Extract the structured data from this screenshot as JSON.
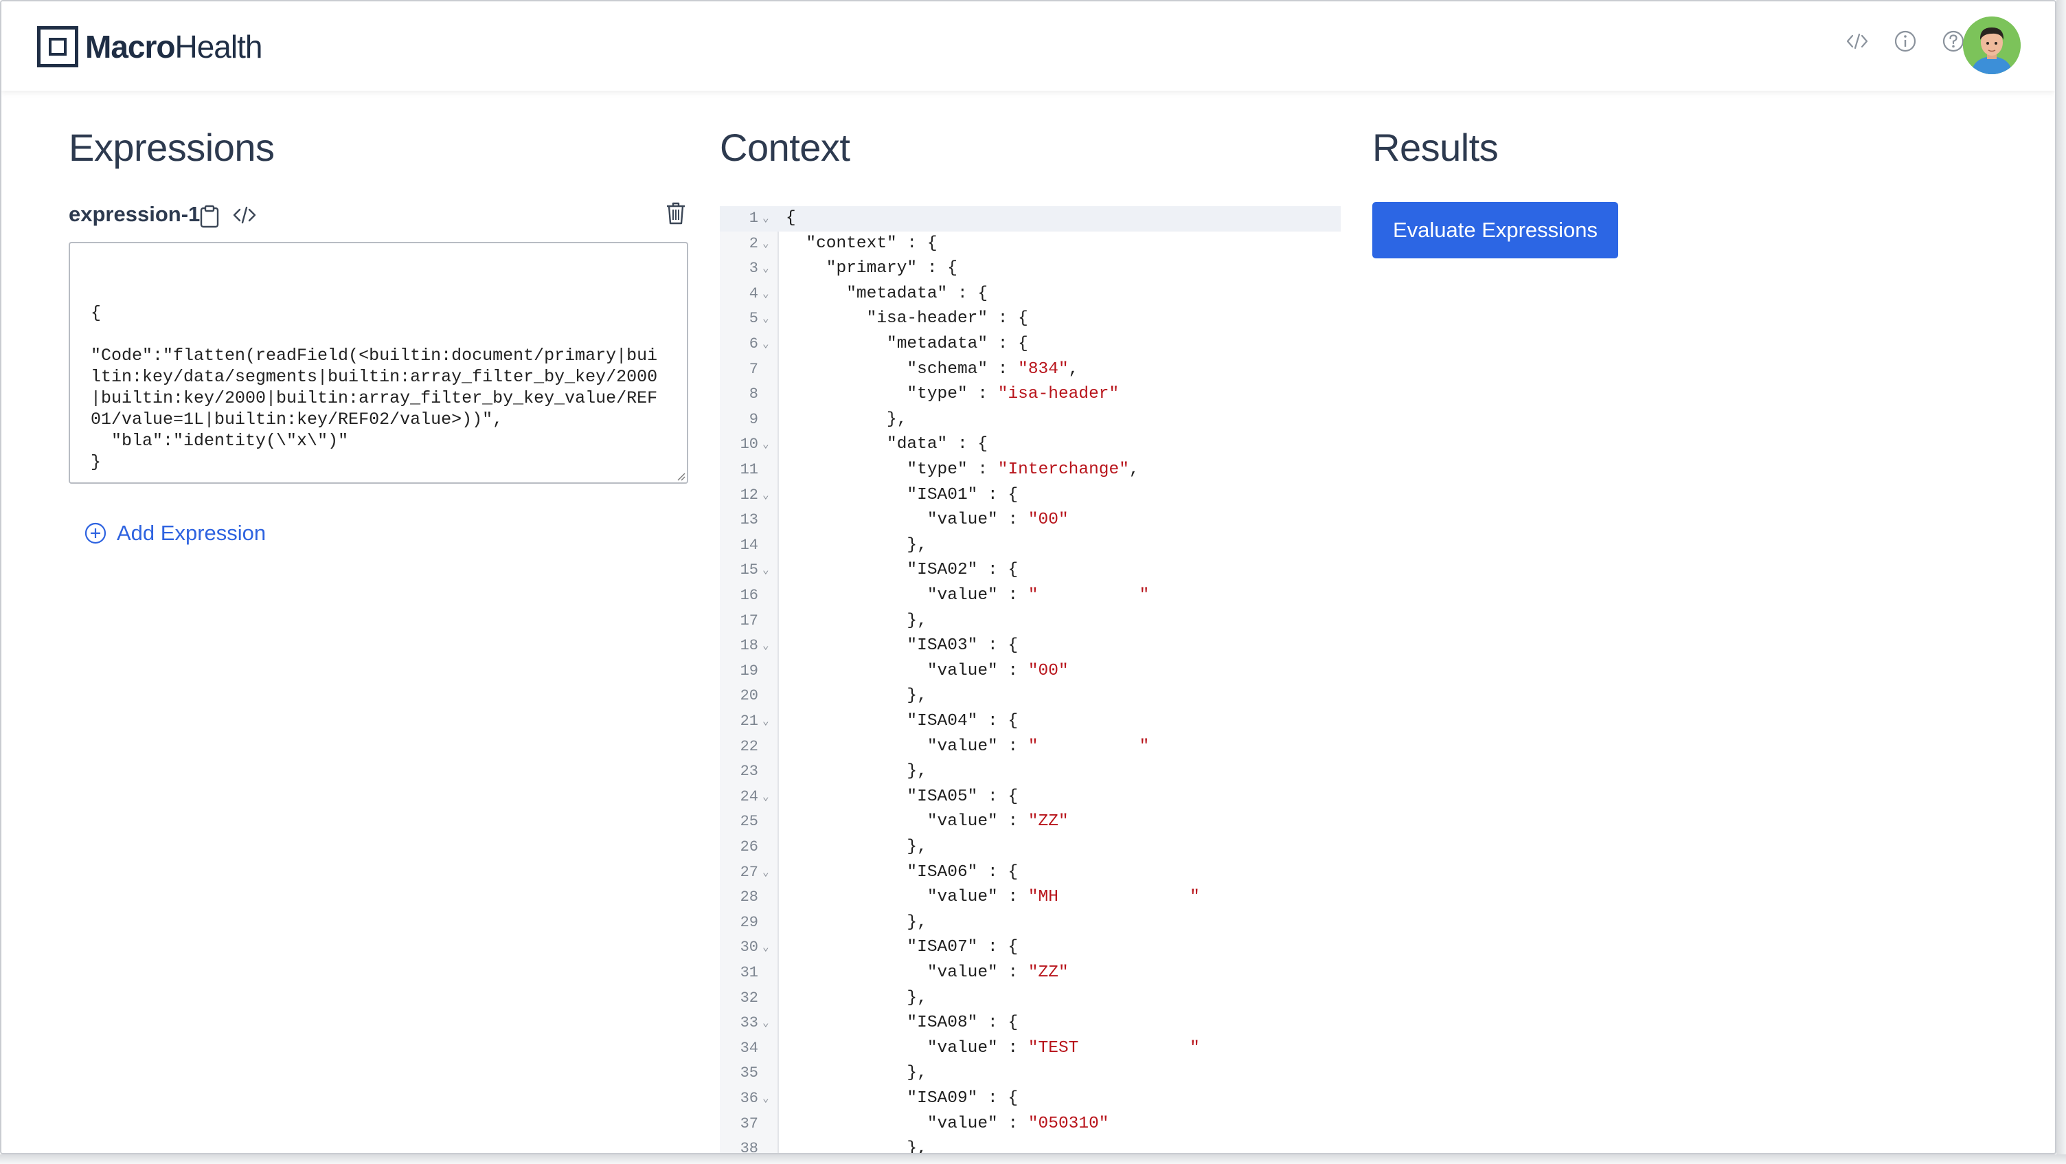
{
  "brand": {
    "name_bold": "Macro",
    "name_light": "Health"
  },
  "header_icons": [
    "code-icon",
    "info-icon",
    "help-icon"
  ],
  "columns": {
    "expressions": "Expressions",
    "context": "Context",
    "results": "Results"
  },
  "expression": {
    "label": "expression-1",
    "text": "{\n\n\"Code\":\"flatten(readField(<builtin:document/primary|builtin:key/data/segments|builtin:array_filter_by_key/2000|builtin:key/2000|builtin:array_filter_by_key_value/REF01/value=1L|builtin:key/REF02/value>))\",\n  \"bla\":\"identity(\\\"x\\\")\"\n}"
  },
  "add_expression_label": "Add Expression",
  "evaluate_label": "Evaluate Expressions",
  "context_lines": [
    {
      "n": "1",
      "fold": true,
      "code": "{",
      "str": ""
    },
    {
      "n": "2",
      "fold": true,
      "code": "  \"context\" : {",
      "str": ""
    },
    {
      "n": "3",
      "fold": true,
      "code": "    \"primary\" : {",
      "str": ""
    },
    {
      "n": "4",
      "fold": true,
      "code": "      \"metadata\" : {",
      "str": ""
    },
    {
      "n": "5",
      "fold": true,
      "code": "        \"isa-header\" : {",
      "str": ""
    },
    {
      "n": "6",
      "fold": true,
      "code": "          \"metadata\" : {",
      "str": ""
    },
    {
      "n": "7",
      "fold": false,
      "code": "            \"schema\" : ",
      "str": "\"834\"",
      "tail": ","
    },
    {
      "n": "8",
      "fold": false,
      "code": "            \"type\" : ",
      "str": "\"isa-header\"",
      "tail": ""
    },
    {
      "n": "9",
      "fold": false,
      "code": "          },",
      "str": ""
    },
    {
      "n": "10",
      "fold": true,
      "code": "          \"data\" : {",
      "str": ""
    },
    {
      "n": "11",
      "fold": false,
      "code": "            \"type\" : ",
      "str": "\"Interchange\"",
      "tail": ","
    },
    {
      "n": "12",
      "fold": true,
      "code": "            \"ISA01\" : {",
      "str": ""
    },
    {
      "n": "13",
      "fold": false,
      "code": "              \"value\" : ",
      "str": "\"00\"",
      "tail": ""
    },
    {
      "n": "14",
      "fold": false,
      "code": "            },",
      "str": ""
    },
    {
      "n": "15",
      "fold": true,
      "code": "            \"ISA02\" : {",
      "str": ""
    },
    {
      "n": "16",
      "fold": false,
      "code": "              \"value\" : ",
      "str": "\"          \"",
      "tail": ""
    },
    {
      "n": "17",
      "fold": false,
      "code": "            },",
      "str": ""
    },
    {
      "n": "18",
      "fold": true,
      "code": "            \"ISA03\" : {",
      "str": ""
    },
    {
      "n": "19",
      "fold": false,
      "code": "              \"value\" : ",
      "str": "\"00\"",
      "tail": ""
    },
    {
      "n": "20",
      "fold": false,
      "code": "            },",
      "str": ""
    },
    {
      "n": "21",
      "fold": true,
      "code": "            \"ISA04\" : {",
      "str": ""
    },
    {
      "n": "22",
      "fold": false,
      "code": "              \"value\" : ",
      "str": "\"          \"",
      "tail": ""
    },
    {
      "n": "23",
      "fold": false,
      "code": "            },",
      "str": ""
    },
    {
      "n": "24",
      "fold": true,
      "code": "            \"ISA05\" : {",
      "str": ""
    },
    {
      "n": "25",
      "fold": false,
      "code": "              \"value\" : ",
      "str": "\"ZZ\"",
      "tail": ""
    },
    {
      "n": "26",
      "fold": false,
      "code": "            },",
      "str": ""
    },
    {
      "n": "27",
      "fold": true,
      "code": "            \"ISA06\" : {",
      "str": ""
    },
    {
      "n": "28",
      "fold": false,
      "code": "              \"value\" : ",
      "str": "\"MH             \"",
      "tail": ""
    },
    {
      "n": "29",
      "fold": false,
      "code": "            },",
      "str": ""
    },
    {
      "n": "30",
      "fold": true,
      "code": "            \"ISA07\" : {",
      "str": ""
    },
    {
      "n": "31",
      "fold": false,
      "code": "              \"value\" : ",
      "str": "\"ZZ\"",
      "tail": ""
    },
    {
      "n": "32",
      "fold": false,
      "code": "            },",
      "str": ""
    },
    {
      "n": "33",
      "fold": true,
      "code": "            \"ISA08\" : {",
      "str": ""
    },
    {
      "n": "34",
      "fold": false,
      "code": "              \"value\" : ",
      "str": "\"TEST           \"",
      "tail": ""
    },
    {
      "n": "35",
      "fold": false,
      "code": "            },",
      "str": ""
    },
    {
      "n": "36",
      "fold": true,
      "code": "            \"ISA09\" : {",
      "str": ""
    },
    {
      "n": "37",
      "fold": false,
      "code": "              \"value\" : ",
      "str": "\"050310\"",
      "tail": ""
    },
    {
      "n": "38",
      "fold": false,
      "code": "            },",
      "str": ""
    }
  ]
}
